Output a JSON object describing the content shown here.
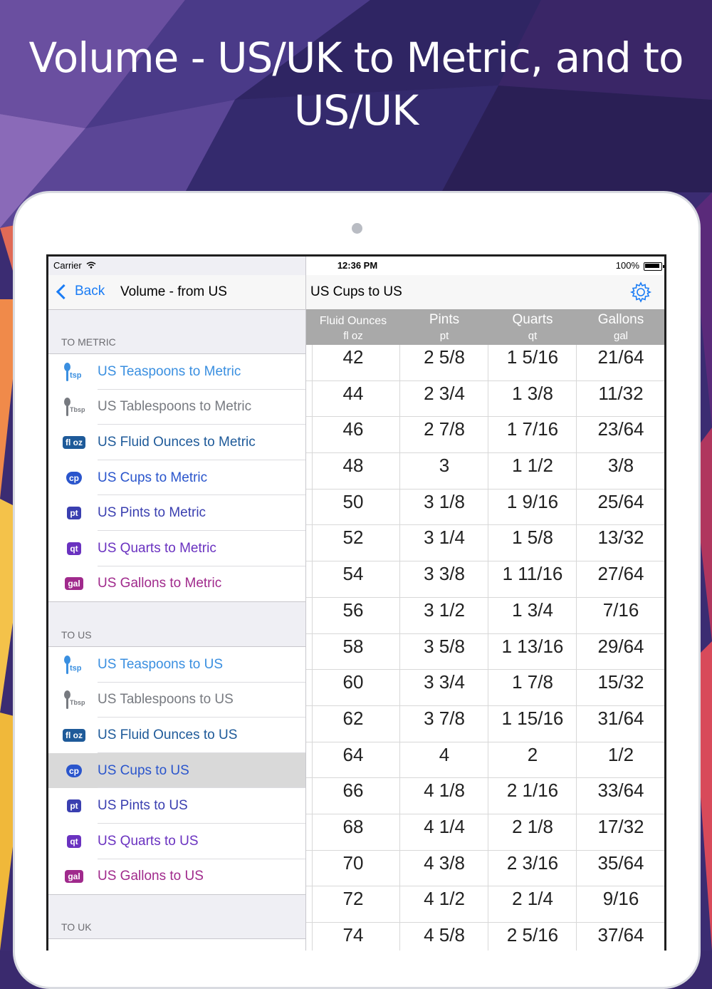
{
  "headline": "Volume - US/UK to Metric, and to US/UK",
  "headline_line1": "Volume - US/UK to Metric, and to",
  "headline_line2": "US/UK",
  "colors": {
    "ios_blue": "#1a7cf5",
    "teaspoon": "#3a8fe0",
    "tablespoon": "#777a80",
    "fluid_ounce": "#1e5a99",
    "cup": "#2a55cc",
    "pint": "#3a3fb0",
    "quart": "#6a32c0",
    "gallon": "#a02a8c"
  },
  "status_bar": {
    "carrier": "Carrier",
    "time": "12:36 PM",
    "battery": "100%"
  },
  "master": {
    "back_label": "Back",
    "title": "Volume - from US",
    "sections": [
      {
        "header": "TO METRIC",
        "items": [
          {
            "label": "US Teaspoons to Metric",
            "icon": "teaspoon-icon",
            "badge": "tsp",
            "color": "#3a8fe0"
          },
          {
            "label": "US Tablespoons to Metric",
            "icon": "tablespoon-icon",
            "badge": "Tbsp",
            "color": "#777a80"
          },
          {
            "label": "US Fluid Ounces to Metric",
            "icon": "fluid-ounce-icon",
            "badge": "fl oz",
            "color": "#1e5a99"
          },
          {
            "label": "US Cups to Metric",
            "icon": "cup-icon",
            "badge": "cp",
            "color": "#2a55cc"
          },
          {
            "label": "US Pints to Metric",
            "icon": "pint-icon",
            "badge": "pt",
            "color": "#3a3fb0"
          },
          {
            "label": "US Quarts to Metric",
            "icon": "quart-icon",
            "badge": "qt",
            "color": "#6a32c0"
          },
          {
            "label": "US Gallons to Metric",
            "icon": "gallon-icon",
            "badge": "gal",
            "color": "#a02a8c"
          }
        ]
      },
      {
        "header": "TO US",
        "items": [
          {
            "label": "US Teaspoons to US",
            "icon": "teaspoon-icon",
            "badge": "tsp",
            "color": "#3a8fe0"
          },
          {
            "label": "US Tablespoons to US",
            "icon": "tablespoon-icon",
            "badge": "Tbsp",
            "color": "#777a80"
          },
          {
            "label": "US Fluid Ounces to US",
            "icon": "fluid-ounce-icon",
            "badge": "fl oz",
            "color": "#1e5a99"
          },
          {
            "label": "US Cups to US",
            "icon": "cup-icon",
            "badge": "cp",
            "color": "#2a55cc",
            "selected": true
          },
          {
            "label": "US Pints to US",
            "icon": "pint-icon",
            "badge": "pt",
            "color": "#3a3fb0"
          },
          {
            "label": "US Quarts to US",
            "icon": "quart-icon",
            "badge": "qt",
            "color": "#6a32c0"
          },
          {
            "label": "US Gallons to US",
            "icon": "gallon-icon",
            "badge": "gal",
            "color": "#a02a8c"
          }
        ]
      },
      {
        "header": "TO UK",
        "items": []
      }
    ]
  },
  "detail": {
    "title": "US Cups to US",
    "settings_icon": "gear-icon",
    "columns": [
      {
        "name": "Fluid Ounces",
        "unit": "fl oz"
      },
      {
        "name": "Pints",
        "unit": "pt"
      },
      {
        "name": "Quarts",
        "unit": "qt"
      },
      {
        "name": "Gallons",
        "unit": "gal"
      }
    ],
    "rows": [
      [
        "42",
        "2 5/8",
        "1 5/16",
        "21/64"
      ],
      [
        "44",
        "2 3/4",
        "1 3/8",
        "11/32"
      ],
      [
        "46",
        "2 7/8",
        "1 7/16",
        "23/64"
      ],
      [
        "48",
        "3",
        "1 1/2",
        "3/8"
      ],
      [
        "50",
        "3 1/8",
        "1 9/16",
        "25/64"
      ],
      [
        "52",
        "3 1/4",
        "1 5/8",
        "13/32"
      ],
      [
        "54",
        "3 3/8",
        "1 11/16",
        "27/64"
      ],
      [
        "56",
        "3 1/2",
        "1 3/4",
        "7/16"
      ],
      [
        "58",
        "3 5/8",
        "1 13/16",
        "29/64"
      ],
      [
        "60",
        "3 3/4",
        "1 7/8",
        "15/32"
      ],
      [
        "62",
        "3 7/8",
        "1 15/16",
        "31/64"
      ],
      [
        "64",
        "4",
        "2",
        "1/2"
      ],
      [
        "66",
        "4 1/8",
        "2 1/16",
        "33/64"
      ],
      [
        "68",
        "4 1/4",
        "2 1/8",
        "17/32"
      ],
      [
        "70",
        "4 3/8",
        "2 3/16",
        "35/64"
      ],
      [
        "72",
        "4 1/2",
        "2 1/4",
        "9/16"
      ],
      [
        "74",
        "4 5/8",
        "2 5/16",
        "37/64"
      ]
    ]
  }
}
